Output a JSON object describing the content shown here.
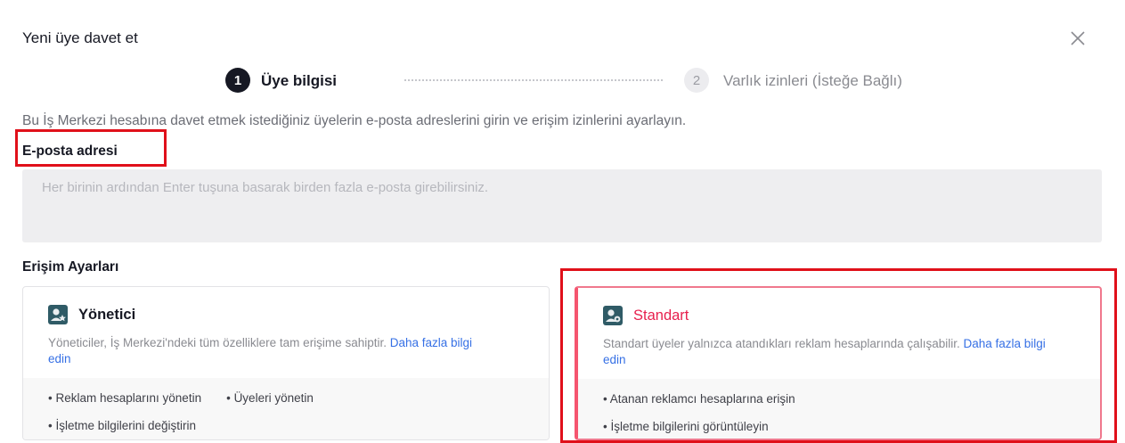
{
  "dialog": {
    "title": "Yeni üye davet et",
    "close_icon": "close-icon"
  },
  "stepper": {
    "steps": [
      {
        "number": "1",
        "label": "Üye bilgisi",
        "state": "active"
      },
      {
        "number": "2",
        "label": "Varlık izinleri (İsteğe Bağlı)",
        "state": "inactive"
      }
    ]
  },
  "description": "Bu İş Merkezi hesabına davet etmek istediğiniz üyelerin e-posta adreslerini girin ve erişim izinlerini ayarlayın.",
  "email": {
    "label": "E-posta adresi",
    "placeholder": "Her birinin ardından Enter tuşuna basarak birden fazla e-posta girebilirsiniz.",
    "value": ""
  },
  "access": {
    "label": "Erişim Ayarları",
    "options": [
      {
        "title": "Yönetici",
        "icon": "admin-star-icon",
        "description": "Yöneticiler, İş Merkezi'ndeki tüm özelliklere tam erişime sahiptir.",
        "link": "Daha fazla bilgi edin",
        "permissions": [
          "Reklam hesaplarını yönetin",
          "Üyeleri yönetin",
          "İşletme bilgilerini değiştirin"
        ],
        "selected": false
      },
      {
        "title": "Standart",
        "icon": "standard-user-icon",
        "description": "Standart üyeler yalnızca atandıkları reklam hesaplarında çalışabilir.",
        "link": "Daha fazla bilgi edin",
        "permissions": [
          "Atanan reklamcı hesaplarına erişin",
          "İşletme bilgilerini görüntüleyin"
        ],
        "selected": true
      }
    ]
  },
  "colors": {
    "accent": "#e71f4d",
    "link": "#3670e5",
    "annotation": "#e0101a"
  }
}
